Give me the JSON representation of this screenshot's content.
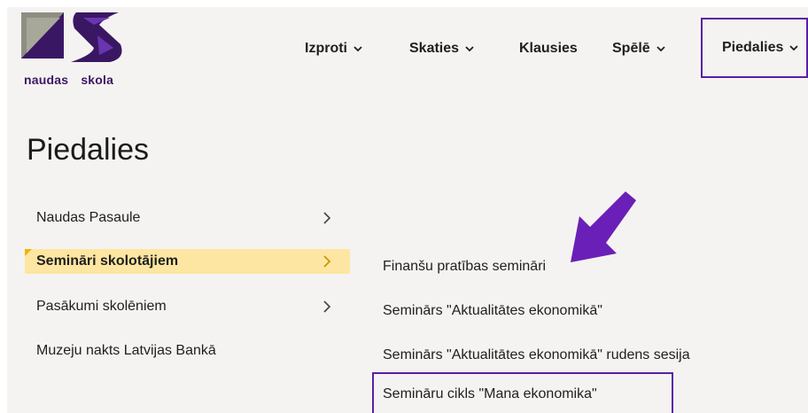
{
  "logo": {
    "word1": "naudas",
    "word2": "skola"
  },
  "nav": [
    {
      "label": "Izproti"
    },
    {
      "label": "Skaties"
    },
    {
      "label": "Klausies"
    },
    {
      "label": "Spēlē"
    },
    {
      "label": "Piedalies"
    }
  ],
  "page_title": "Piedalies",
  "left_menu": [
    {
      "label": "Naudas Pasaule"
    },
    {
      "label": "Semināri skolotājiem"
    },
    {
      "label": "Pasākumi skolēniem"
    },
    {
      "label": "Muzeju nakts Latvijas Bankā"
    }
  ],
  "sub_menu": [
    {
      "label": "Finanšu pratības semināri"
    },
    {
      "label": "Seminārs \"Aktualitātes ekonomikā\""
    },
    {
      "label": "Seminārs \"Aktualitātes ekonomikā\" rudens sesija"
    },
    {
      "label": "Semināru cikls \"Mana ekonomika\""
    }
  ],
  "colors": {
    "accent_purple": "#5a1fa5",
    "active_bg": "#fce6a1",
    "logo_gray": "#a8a89a",
    "logo_purple": "#3a1763"
  }
}
